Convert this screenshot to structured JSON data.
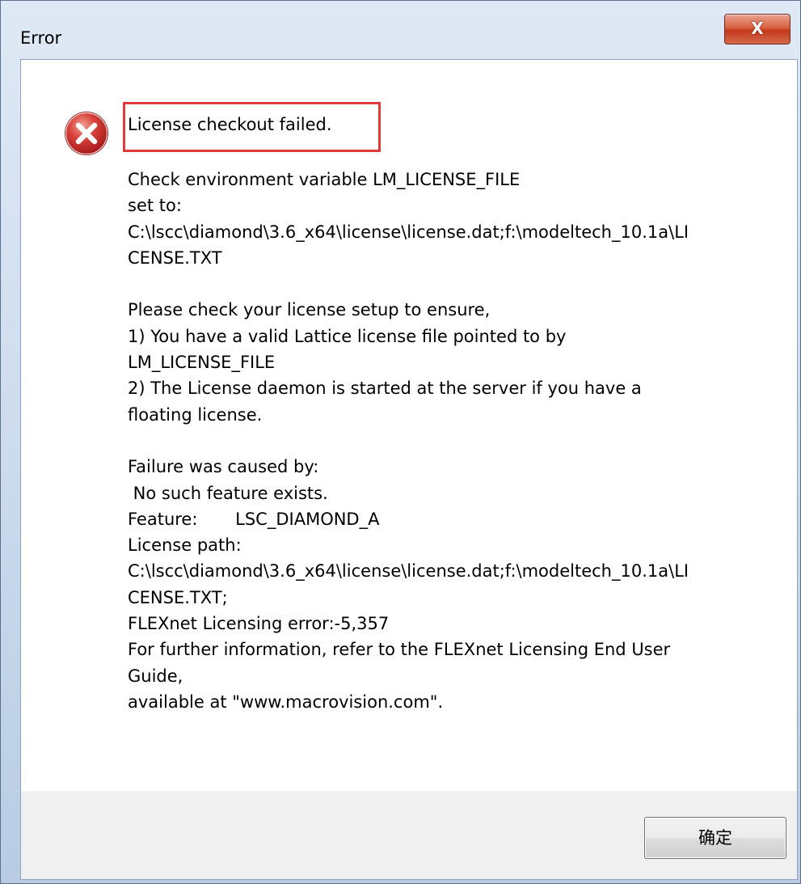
{
  "window": {
    "title": "Error",
    "close_label": "X"
  },
  "message": {
    "headline": "License checkout failed.",
    "body": "Check environment variable LM_LICENSE_FILE\nset to:\nC:\\lscc\\diamond\\3.6_x64\\license\\license.dat;f:\\modeltech_10.1a\\LI\nCENSE.TXT\n\nPlease check your license setup to ensure,\n1) You have a valid Lattice license file pointed to by\nLM_LICENSE_FILE\n2) The License daemon is started at the server if you have a\nfloating license.\n\nFailure was caused by:\n No such feature exists.\nFeature:       LSC_DIAMOND_A\nLicense path:\nC:\\lscc\\diamond\\3.6_x64\\license\\license.dat;f:\\modeltech_10.1a\\LI\nCENSE.TXT;\nFLEXnet Licensing error:-5,357\nFor further information, refer to the FLEXnet Licensing End User\nGuide,\navailable at \"www.macrovision.com\"."
  },
  "buttons": {
    "ok_label": "确定"
  },
  "icons": {
    "error": "error-icon",
    "close": "close-icon"
  },
  "colors": {
    "highlight": "#e03a3a",
    "close_button": "#c4391c",
    "error_icon": "#d3302b"
  }
}
